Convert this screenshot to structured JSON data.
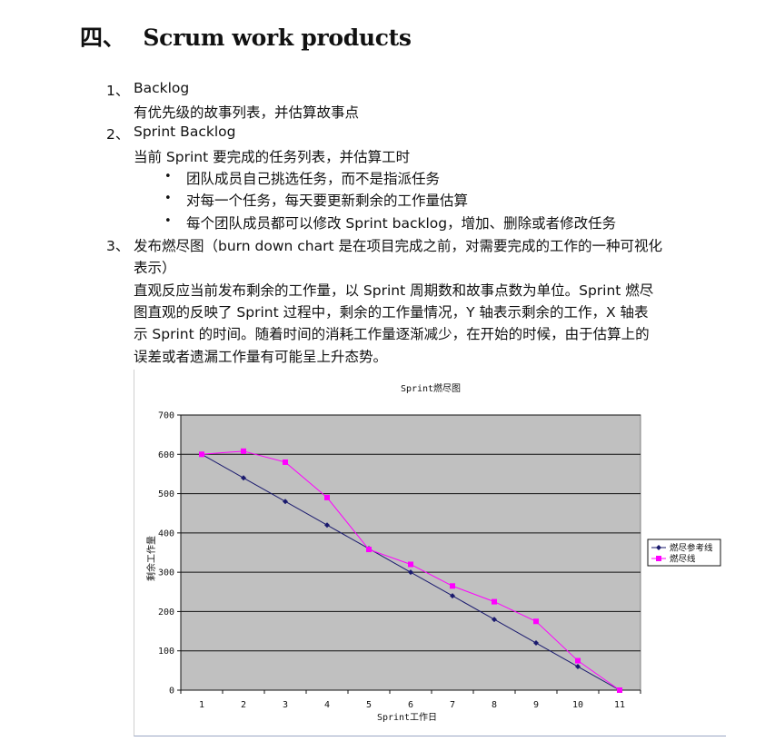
{
  "section": {
    "number": "四、",
    "title": "Scrum work products"
  },
  "items": [
    {
      "marker": "1、",
      "title": "Backlog",
      "desc": "有优先级的故事列表，并估算故事点"
    },
    {
      "marker": "2、",
      "title": "Sprint Backlog",
      "desc": "当前 Sprint 要完成的任务列表，并估算工时",
      "bullets": [
        "团队成员自己挑选任务，而不是指派任务",
        "对每一个任务，每天要更新剩余的工作量估算",
        "每个团队成员都可以修改 Sprint backlog，增加、删除或者修改任务"
      ]
    },
    {
      "marker": "3、",
      "title_lines": [
        "发布燃尽图（burn down chart 是在项目完成之前，对需要完成的工作的一种可视化",
        "表示）"
      ],
      "desc_lines": [
        "直观反应当前发布剩余的工作量，以 Sprint 周期数和故事点数为单位。Sprint 燃尽",
        "图直观的反映了 Sprint 过程中，剩余的工作量情况，Y 轴表示剩余的工作，X 轴表",
        "示 Sprint 的时间。随着时间的消耗工作量逐渐减少，在开始的时候，由于估算上的",
        "误差或者遗漏工作量有可能呈上升态势。"
      ]
    }
  ],
  "chart_data": {
    "type": "line",
    "title": "Sprint燃尽图",
    "xlabel": "Sprint工作日",
    "ylabel": "剩余工作量",
    "categories": [
      1,
      2,
      3,
      4,
      5,
      6,
      7,
      8,
      9,
      10,
      11
    ],
    "ylim": [
      0,
      700
    ],
    "yticks": [
      0,
      100,
      200,
      300,
      400,
      500,
      600,
      700
    ],
    "grid": true,
    "legend": "right",
    "series": [
      {
        "name": "燃尽参考线",
        "color": "#1a1a6e",
        "marker": "diamond",
        "values": [
          600,
          540,
          480,
          420,
          360,
          300,
          240,
          180,
          120,
          60,
          0
        ]
      },
      {
        "name": "燃尽线",
        "color": "#ff00ff",
        "marker": "square",
        "values": [
          600,
          608,
          580,
          490,
          358,
          320,
          265,
          225,
          175,
          75,
          0
        ]
      }
    ],
    "plot_bg": "#c0c0c0"
  }
}
